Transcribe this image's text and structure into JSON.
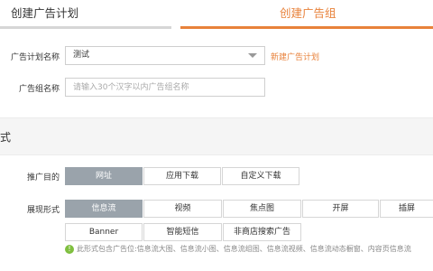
{
  "tabs": [
    {
      "label": "创建广告计划",
      "active": false
    },
    {
      "label": "创建广告组",
      "active": true
    }
  ],
  "colors": {
    "accent": "#e8823b",
    "selected": "#9aa3ab",
    "note_icon": "#7fbf3f"
  },
  "form": {
    "plan_name": {
      "label": "广告计划名称",
      "value": "测试",
      "link": "新建广告计划"
    },
    "group_name": {
      "label": "广告组名称",
      "placeholder": "请输入30个汉字以内广告组名称"
    }
  },
  "section": {
    "title": "式"
  },
  "promo_goal": {
    "label": "推广目的",
    "options": [
      "网址",
      "应用下载",
      "自定义下载"
    ],
    "selected": "网址"
  },
  "display_form": {
    "label": "展现形式",
    "options": [
      "信息流",
      "视频",
      "焦点图",
      "开屏",
      "插屏",
      "Banner",
      "智能短信",
      "非商店搜索广告"
    ],
    "selected": "信息流",
    "note": "此形式包含广告位:信息流大图、信息流小图、信息流组图、信息流视频、信息流动态橱窗、内容页信息流"
  }
}
